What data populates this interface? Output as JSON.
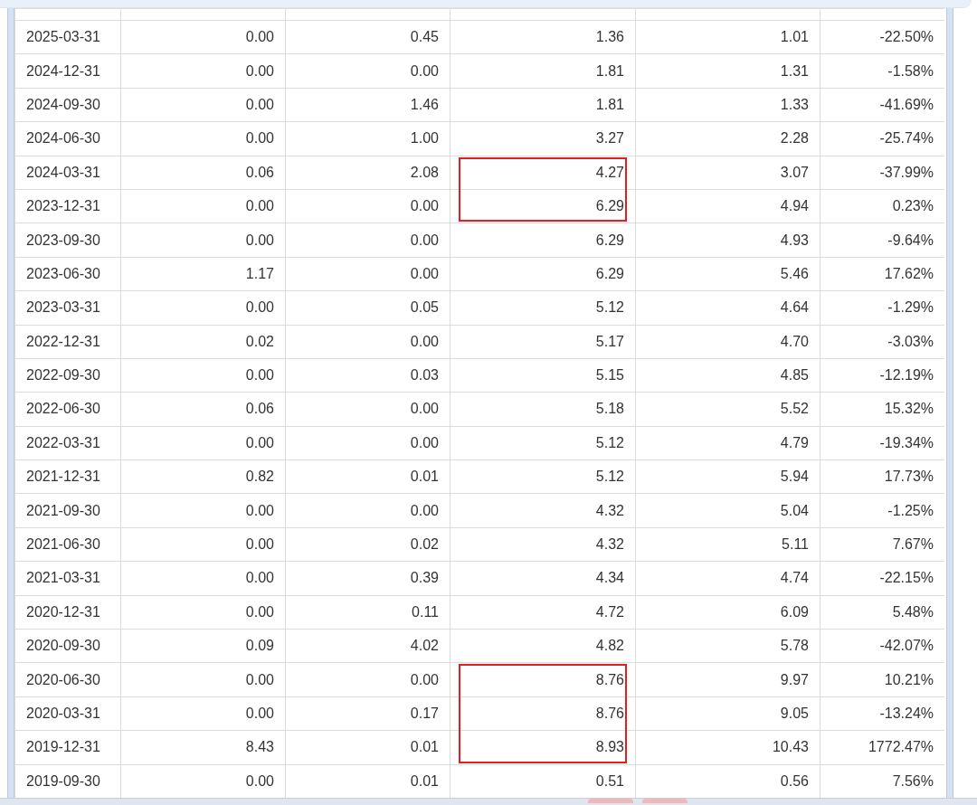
{
  "table": {
    "rows": [
      {
        "cells": [
          "2025-03-31",
          "0.00",
          "0.45",
          "1.36",
          "1.01",
          "-22.50%"
        ],
        "marked": false
      },
      {
        "cells": [
          "2024-12-31",
          "0.00",
          "0.00",
          "1.81",
          "1.31",
          "-1.58%"
        ],
        "marked": false
      },
      {
        "cells": [
          "2024-09-30",
          "0.00",
          "1.46",
          "1.81",
          "1.33",
          "-41.69%"
        ],
        "marked": false
      },
      {
        "cells": [
          "2024-06-30",
          "0.00",
          "1.00",
          "3.27",
          "2.28",
          "-25.74%"
        ],
        "marked": false
      },
      {
        "cells": [
          "2024-03-31",
          "0.06",
          "2.08",
          "4.27",
          "3.07",
          "-37.99%"
        ],
        "marked": true
      },
      {
        "cells": [
          "2023-12-31",
          "0.00",
          "0.00",
          "6.29",
          "4.94",
          "0.23%"
        ],
        "marked": true
      },
      {
        "cells": [
          "2023-09-30",
          "0.00",
          "0.00",
          "6.29",
          "4.93",
          "-9.64%"
        ],
        "marked": false
      },
      {
        "cells": [
          "2023-06-30",
          "1.17",
          "0.00",
          "6.29",
          "5.46",
          "17.62%"
        ],
        "marked": false
      },
      {
        "cells": [
          "2023-03-31",
          "0.00",
          "0.05",
          "5.12",
          "4.64",
          "-1.29%"
        ],
        "marked": false
      },
      {
        "cells": [
          "2022-12-31",
          "0.02",
          "0.00",
          "5.17",
          "4.70",
          "-3.03%"
        ],
        "marked": false
      },
      {
        "cells": [
          "2022-09-30",
          "0.00",
          "0.03",
          "5.15",
          "4.85",
          "-12.19%"
        ],
        "marked": false
      },
      {
        "cells": [
          "2022-06-30",
          "0.06",
          "0.00",
          "5.18",
          "5.52",
          "15.32%"
        ],
        "marked": false
      },
      {
        "cells": [
          "2022-03-31",
          "0.00",
          "0.00",
          "5.12",
          "4.79",
          "-19.34%"
        ],
        "marked": false
      },
      {
        "cells": [
          "2021-12-31",
          "0.82",
          "0.01",
          "5.12",
          "5.94",
          "17.73%"
        ],
        "marked": false
      },
      {
        "cells": [
          "2021-09-30",
          "0.00",
          "0.00",
          "4.32",
          "5.04",
          "-1.25%"
        ],
        "marked": false
      },
      {
        "cells": [
          "2021-06-30",
          "0.00",
          "0.02",
          "4.32",
          "5.11",
          "7.67%"
        ],
        "marked": false
      },
      {
        "cells": [
          "2021-03-31",
          "0.00",
          "0.39",
          "4.34",
          "4.74",
          "-22.15%"
        ],
        "marked": false
      },
      {
        "cells": [
          "2020-12-31",
          "0.00",
          "0.11",
          "4.72",
          "6.09",
          "5.48%"
        ],
        "marked": false
      },
      {
        "cells": [
          "2020-09-30",
          "0.09",
          "4.02",
          "4.82",
          "5.78",
          "-42.07%"
        ],
        "marked": false
      },
      {
        "cells": [
          "2020-06-30",
          "0.00",
          "0.00",
          "8.76",
          "9.97",
          "10.21%"
        ],
        "marked": true
      },
      {
        "cells": [
          "2020-03-31",
          "0.00",
          "0.17",
          "8.76",
          "9.05",
          "-13.24%"
        ],
        "marked": true
      },
      {
        "cells": [
          "2019-12-31",
          "8.43",
          "0.01",
          "8.93",
          "10.43",
          "1772.47%"
        ],
        "marked": true
      },
      {
        "cells": [
          "2019-09-30",
          "0.00",
          "0.01",
          "0.51",
          "0.56",
          "7.56%"
        ],
        "marked": false
      }
    ]
  }
}
